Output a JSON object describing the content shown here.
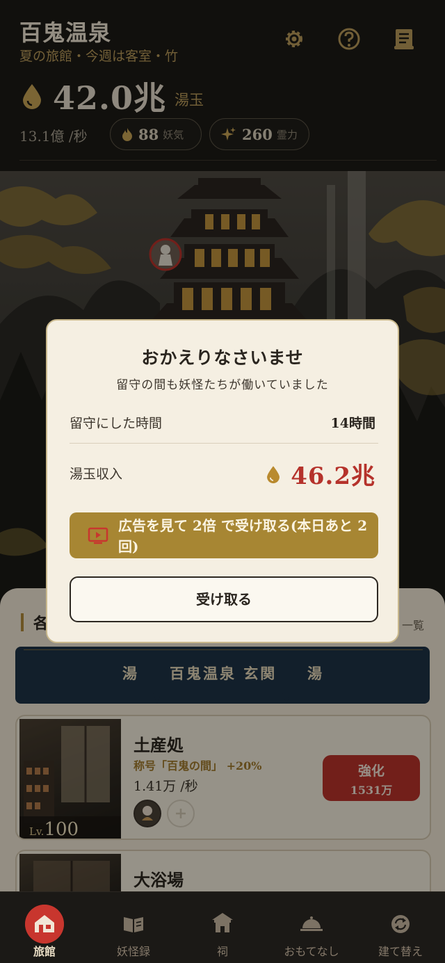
{
  "header": {
    "title": "百鬼温泉",
    "subtitle": "夏の旅館・今週は客室・竹",
    "currency_amount": "42.0兆",
    "currency_unit": "湯玉",
    "rate": "13.1億 /秒",
    "youki": {
      "value": "88",
      "label": "妖気"
    },
    "reiryoku": {
      "value": "260",
      "label": "霊力"
    }
  },
  "section": {
    "title": "各",
    "link": "一覧"
  },
  "banner": {
    "left": "湯",
    "center": "百鬼温泉 玄関",
    "right": "湯"
  },
  "cards": [
    {
      "name": "土産処",
      "title": "称号「百鬼の間」 +20%",
      "rate": "1.41万 /秒",
      "level_prefix": "Lv.",
      "level": "100",
      "upgrade_label": "強化",
      "upgrade_cost": "1531万"
    },
    {
      "name": "大浴場"
    }
  ],
  "modal": {
    "title": "おかえりなさいませ",
    "subtitle": "留守の間も妖怪たちが働いていました",
    "away_label": "留守にした時間",
    "away_value": "14時間",
    "income_label": "湯玉収入",
    "income_value": "46.2兆",
    "ad_button": "広告を見て 2倍 で受け取る(本日あと 2 回)",
    "claim_button": "受け取る"
  },
  "nav": [
    {
      "label": "旅館",
      "icon": "inn-icon",
      "active": true
    },
    {
      "label": "妖怪録",
      "icon": "book-icon",
      "active": false
    },
    {
      "label": "祠",
      "icon": "shrine-icon",
      "active": false
    },
    {
      "label": "おもてなし",
      "icon": "cloche-icon",
      "active": false
    },
    {
      "label": "建て替え",
      "icon": "rebuild-icon",
      "active": false
    }
  ],
  "colors": {
    "accent_gold": "#a78633",
    "accent_red": "#b5322b",
    "banner_navy": "#1e3246"
  }
}
